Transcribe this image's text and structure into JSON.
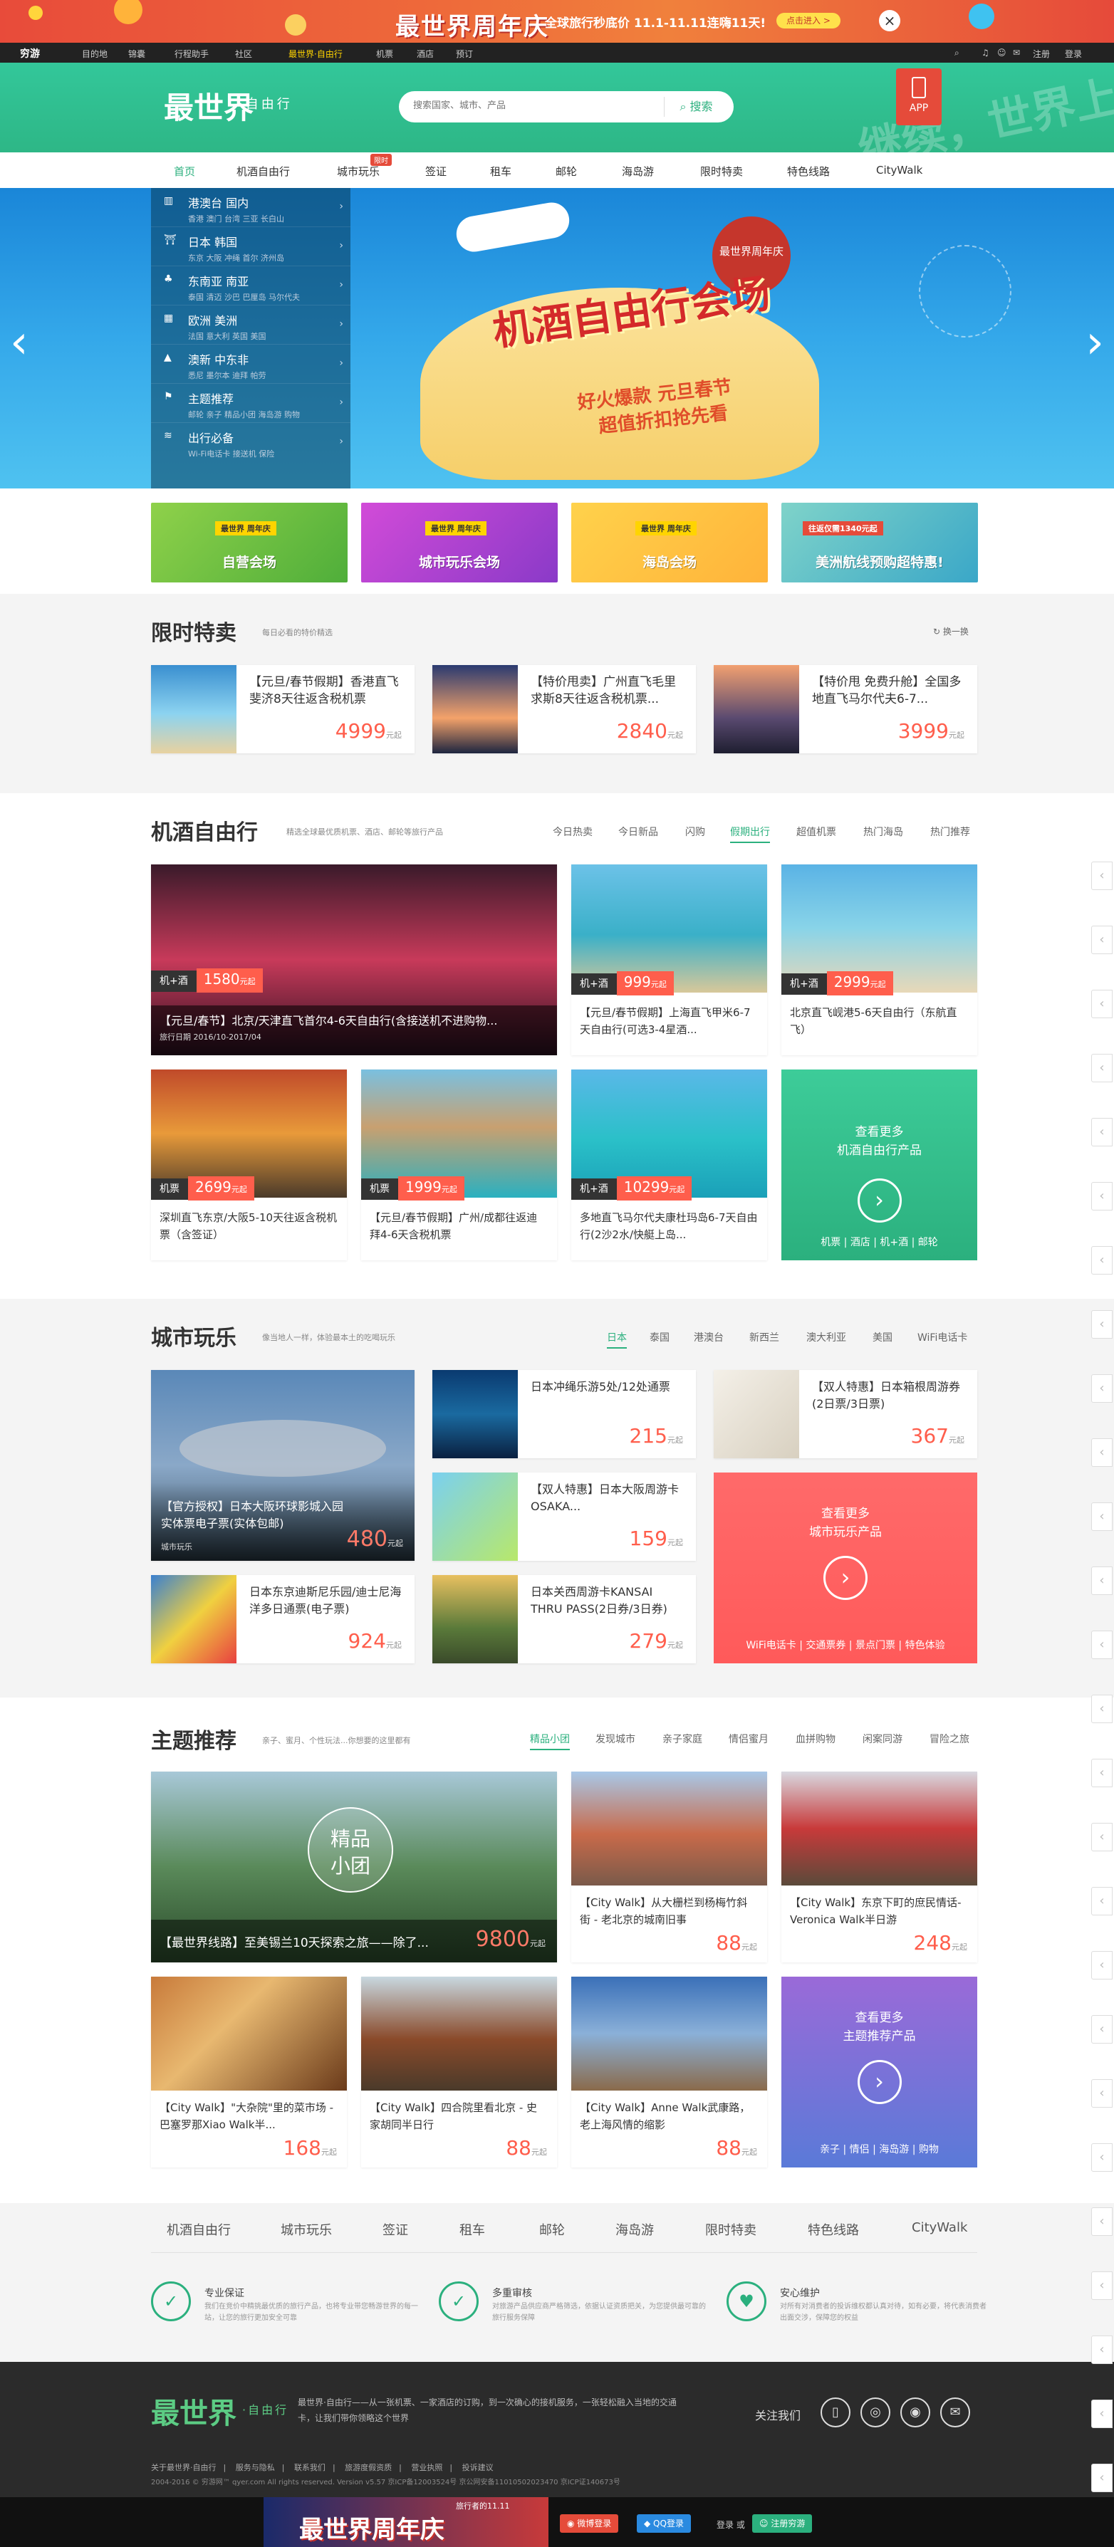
{
  "top_banner": {
    "title": "最世界周年庆",
    "subtitle": "全球旅行秒底价 11.1-11.11连嗨11天!",
    "button": "点击进入 >",
    "close": "×"
  },
  "top_nav": {
    "logo": "穷游",
    "items": [
      "目的地",
      "锦囊",
      "行程助手",
      "社区",
      "最世界·自由行",
      "机票",
      "酒店",
      "预订"
    ],
    "right": [
      "注册",
      "登录"
    ]
  },
  "header": {
    "brand": "最世界",
    "brand_sub": "·自由行",
    "search_placeholder": "搜索国家、城市、产品",
    "search_button": "搜索",
    "app_label": "APP",
    "watermark": "继续，世界上瘾"
  },
  "main_nav": {
    "items": [
      "首页",
      "机酒自由行",
      "城市玩乐",
      "签证",
      "租车",
      "邮轮",
      "海岛游",
      "限时特卖",
      "特色线路",
      "CityWalk"
    ],
    "badge": "限时"
  },
  "hero": {
    "categories": [
      {
        "title": "港澳台 国内",
        "sub": "香港 澳门 台湾 三亚 长白山"
      },
      {
        "title": "日本 韩国",
        "sub": "东京 大阪 冲绳 首尔 济州岛"
      },
      {
        "title": "东南亚 南亚",
        "sub": "泰国 清迈 沙巴 巴厘岛 马尔代夫"
      },
      {
        "title": "欧洲 美洲",
        "sub": "法国 意大利 英国 美国"
      },
      {
        "title": "澳新 中东非",
        "sub": "悉尼 墨尔本 迪拜 帕劳"
      },
      {
        "title": "主题推荐",
        "sub": "邮轮 亲子 精品小团 海岛游 购物"
      },
      {
        "title": "出行必备",
        "sub": "Wi-Fi电话卡 接送机 保险"
      }
    ],
    "main_text": "机酒自由行会场",
    "stamp": "最世界周年庆",
    "line1": "好火爆款 元旦春节",
    "line2": "超值折扣抢先看"
  },
  "promos": [
    {
      "tag": "最世界 周年庆",
      "label": "自营会场"
    },
    {
      "tag": "最世界 周年庆",
      "label": "城市玩乐会场"
    },
    {
      "tag": "最世界 周年庆",
      "label": "海岛会场"
    },
    {
      "tag": "往返仅需1340元起",
      "label": "美洲航线预购超特惠!"
    }
  ],
  "flash_sale": {
    "title": "限时特卖",
    "sub": "每日必看的特价精选",
    "refresh": "换一换",
    "items": [
      {
        "title": "【元旦/春节假期】香港直飞斐济8天往返含税机票",
        "price": "4999",
        "unit": "元起"
      },
      {
        "title": "【特价甩卖】广州直飞毛里求斯8天往返含税机票...",
        "price": "2840",
        "unit": "元起"
      },
      {
        "title": "【特价甩 免费升舱】全国多地直飞马尔代夫6-7...",
        "price": "3999",
        "unit": "元起"
      }
    ]
  },
  "flight_hotel": {
    "title": "机酒自由行",
    "sub": "精选全球最优质机票、酒店、邮轮等旅行产品",
    "tabs": [
      "今日热卖",
      "今日新品",
      "闪购",
      "假期出行",
      "超值机票",
      "热门海岛",
      "热门推荐"
    ],
    "big": {
      "kind": "机+酒",
      "price": "1580",
      "unit": "元起",
      "title": "【元旦/春节】北京/天津直飞首尔4-6天自由行(含接送机不进购物...",
      "date": "旅行日期 2016/10-2017/04"
    },
    "items": [
      {
        "kind": "机+酒",
        "price": "999",
        "unit": "元起",
        "title": "【元旦/春节假期】上海直飞甲米6-7天自由行(可选3-4星酒..."
      },
      {
        "kind": "机+酒",
        "price": "2999",
        "unit": "元起",
        "title": "北京直飞岘港5-6天自由行（东航直飞）"
      },
      {
        "kind": "机票",
        "price": "2699",
        "unit": "元起",
        "title": "深圳直飞东京/大阪5-10天往返含税机票（含签证）"
      },
      {
        "kind": "机票",
        "price": "1999",
        "unit": "元起",
        "title": "【元旦/春节假期】广州/成都往返迪拜4-6天含税机票"
      },
      {
        "kind": "机+酒",
        "price": "10299",
        "unit": "元起",
        "title": "多地直飞马尔代夫康杜玛岛6-7天自由行(2沙2水/快艇上岛..."
      }
    ],
    "more": {
      "line1": "查看更多",
      "line2": "机酒自由行产品",
      "bottom": "机票 | 酒店 | 机+酒 | 邮轮"
    }
  },
  "city_fun": {
    "title": "城市玩乐",
    "sub": "像当地人一样，体验最本土的吃喝玩乐",
    "tabs": [
      "日本",
      "泰国",
      "港澳台",
      "新西兰",
      "澳大利亚",
      "美国",
      "WiFi电话卡"
    ],
    "big": {
      "title": "【官方授权】日本大阪环球影城入园实体票电子票(实体包邮)",
      "price": "480",
      "unit": "元起",
      "kind": "城市玩乐"
    },
    "items": [
      {
        "title": "日本冲绳乐游5处/12处通票",
        "price": "215",
        "unit": "元起"
      },
      {
        "title": "【双人特惠】日本箱根周游券(2日票/3日票)",
        "price": "367",
        "unit": "元起"
      },
      {
        "title": "【双人特惠】日本大阪周游卡OSAKA...",
        "price": "159",
        "unit": "元起"
      },
      {
        "title": "日本东京迪斯尼乐园/迪士尼海洋多日通票(电子票)",
        "price": "924",
        "unit": "元起"
      },
      {
        "title": "日本关西周游卡KANSAI THRU PASS(2日券/3日券)",
        "price": "279",
        "unit": "元起"
      }
    ],
    "more": {
      "line1": "查看更多",
      "line2": "城市玩乐产品",
      "bottom": "WiFi电话卡 | 交通票券 | 景点门票 | 特色体验"
    }
  },
  "themes": {
    "title": "主题推荐",
    "sub": "亲子、蜜月、个性玩法...你想要的这里都有",
    "tabs": [
      "精品小团",
      "发现城市",
      "亲子家庭",
      "情侣蜜月",
      "血拼购物",
      "闲案同游",
      "冒险之旅"
    ],
    "big": {
      "title": "【最世界线路】至美锡兰10天探索之旅——除了...",
      "price": "9800",
      "unit": "元起",
      "badge1": "精品",
      "badge2": "小团"
    },
    "items": [
      {
        "title": "【City Walk】从大栅栏到杨梅竹斜街 - 老北京的城南旧事",
        "price": "88",
        "unit": "元起"
      },
      {
        "title": "【City Walk】东京下町的庶民情话- Veronica Walk半日游",
        "price": "248",
        "unit": "元起"
      },
      {
        "title": "【City Walk】\"大杂院\"里的菜市场 - 巴塞罗那Xiao Walk半...",
        "price": "168",
        "unit": "元起"
      },
      {
        "title": "【City Walk】四合院里看北京 - 史家胡同半日行",
        "price": "88",
        "unit": "元起"
      },
      {
        "title": "【City Walk】Anne Walk武康路，老上海风情的缩影",
        "price": "88",
        "unit": "元起"
      }
    ],
    "more": {
      "line1": "查看更多",
      "line2": "主题推荐产品",
      "bottom": "亲子 | 情侣 | 海岛游 | 购物"
    }
  },
  "footer_nav": [
    "机酒自由行",
    "城市玩乐",
    "签证",
    "租车",
    "邮轮",
    "海岛游",
    "限时特卖",
    "特色线路",
    "CityWalk"
  ],
  "promises": [
    {
      "title": "专业保证",
      "desc": "我们在竞价中精挑最优质的旅行产品，也将专业带您畅游世界的每一站，让您的旅行更加安全可靠"
    },
    {
      "title": "多重审核",
      "desc": "对旅游产品供应商严格筛选，依据认证资质把关，为您提供最可靠的旅行服务保障"
    },
    {
      "title": "安心维护",
      "desc": "对所有对消费者的投诉维权都认真对待，如有必要，将代表消费者出面交涉，保障您的权益"
    }
  ],
  "dark_footer": {
    "logo": "最世界",
    "logo_sub": "·自由行",
    "desc": "最世界·自由行——从一张机票、一家酒店的订购，到一次确心的接机服务，一张轻松融入当地的交通卡，让我们带你领略这个世界",
    "follow": "关注我们",
    "links": [
      "关于最世界·自由行",
      "服务与隐私",
      "联系我们",
      "旅游度假资质",
      "营业执照",
      "投诉建议"
    ],
    "copyright": "2004-2016 © 穷游网™ qyer.com All rights reserved. Version v5.57 京ICP备12003524号 京公网安备11010502023470 京ICP证140673号"
  },
  "bottom_bar": {
    "text": "旅行者的11.11",
    "title": "最世界周年庆",
    "weibo": "微博登录",
    "qq": "QQ登录",
    "or": "登录 或",
    "register": "注册穷游"
  }
}
